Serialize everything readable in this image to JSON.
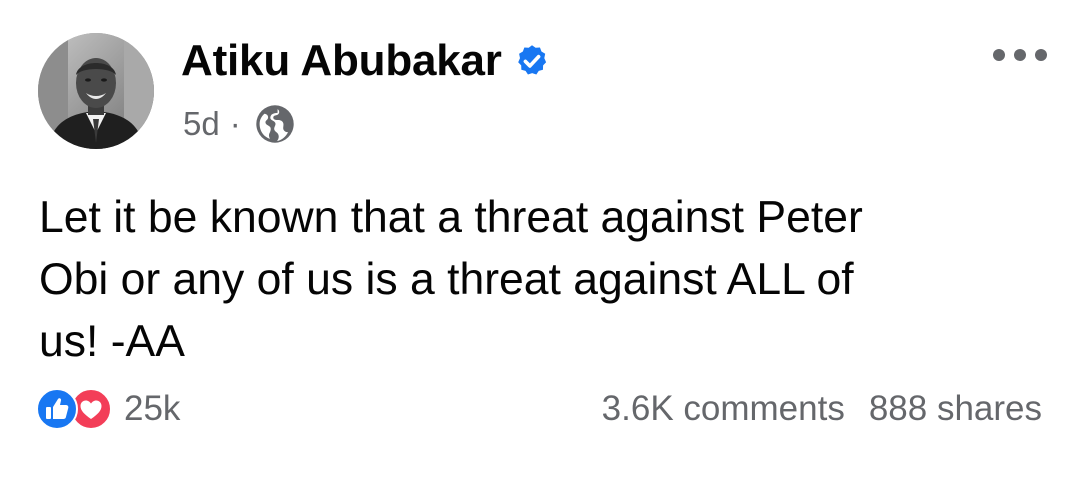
{
  "post": {
    "author": "Atiku Abubakar",
    "verified": true,
    "time": "5d",
    "separator": "·",
    "audience_icon": "globe-icon",
    "text_lines": [
      "Let it be known that a threat against Peter",
      "Obi or any of us is a threat against ALL of",
      "us! -AA"
    ]
  },
  "footer": {
    "reaction_icons": [
      "like-icon",
      "love-icon"
    ],
    "reaction_count": "25k",
    "comments": "3.6K comments",
    "shares": "888 shares"
  },
  "colors": {
    "text": "#050505",
    "secondary": "#65676b",
    "verified_blue": "#1877f2",
    "like_blue": "#1877f2",
    "love_red": "#f33e58"
  }
}
